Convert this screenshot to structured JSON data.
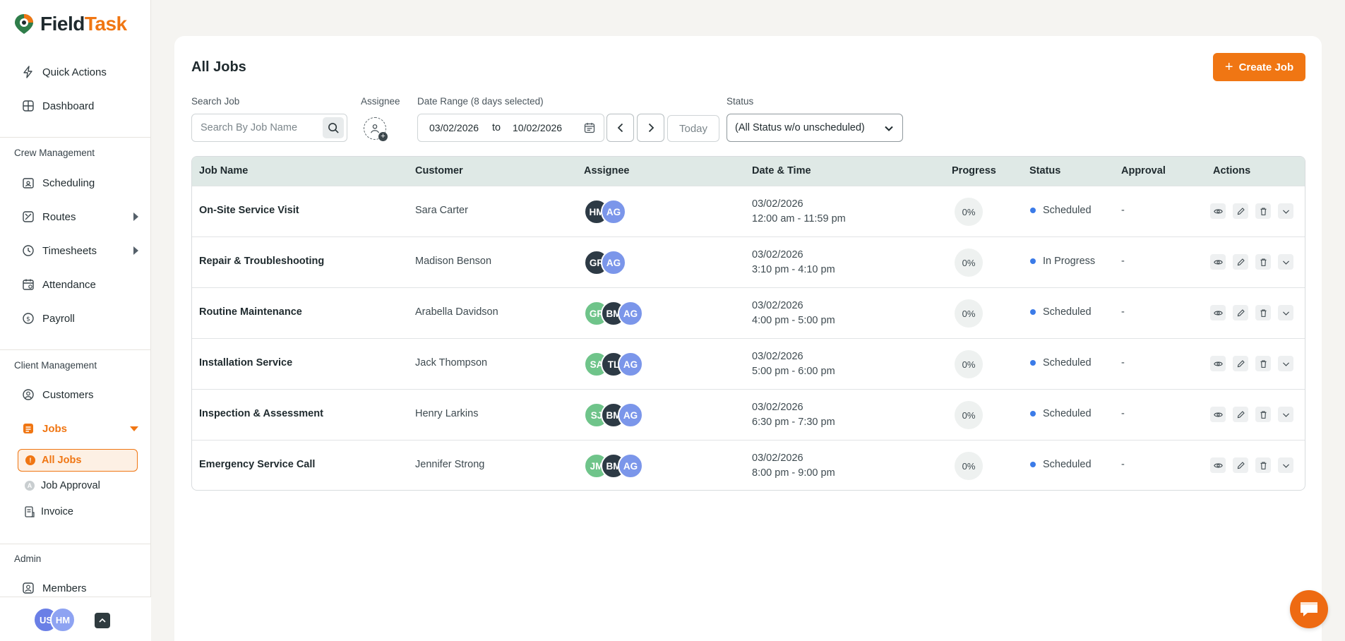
{
  "app": {
    "brand_first": "Field",
    "brand_second": "Task",
    "accent": "#f07613"
  },
  "sidebar": {
    "top_items": [
      {
        "label": "Quick Actions",
        "icon": "bolt-icon"
      },
      {
        "label": "Dashboard",
        "icon": "dashboard-icon"
      }
    ],
    "crew_label": "Crew Management",
    "crew_items": [
      {
        "label": "Scheduling",
        "icon": "scheduling-icon"
      },
      {
        "label": "Routes",
        "icon": "routes-icon",
        "expandable": true
      },
      {
        "label": "Timesheets",
        "icon": "clock-icon",
        "expandable": true
      },
      {
        "label": "Attendance",
        "icon": "attendance-icon"
      },
      {
        "label": "Payroll",
        "icon": "payroll-icon"
      }
    ],
    "client_label": "Client Management",
    "client_items": [
      {
        "label": "Customers",
        "icon": "customers-icon"
      },
      {
        "label": "Jobs",
        "icon": "jobs-icon",
        "expanded": true
      }
    ],
    "jobs_sub": [
      {
        "label": "All Jobs",
        "active": true
      },
      {
        "label": "Job Approval"
      },
      {
        "label": "Invoice"
      }
    ],
    "admin_label": "Admin",
    "admin_items": [
      {
        "label": "Members",
        "icon": "members-icon"
      }
    ],
    "footer_avatars": [
      {
        "initials": "US"
      },
      {
        "initials": "HM"
      }
    ]
  },
  "main": {
    "title": "All Jobs",
    "create_label": "Create Job",
    "filters": {
      "search_label": "Search Job",
      "search_placeholder": "Search By Job Name",
      "assignee_label": "Assignee",
      "date_label": "Date Range (8 days selected)",
      "date_from": "03/02/2026",
      "date_to_word": "to",
      "date_to": "10/02/2026",
      "today_label": "Today",
      "status_label": "Status",
      "status_value": "(All Status w/o unscheduled)"
    },
    "columns": {
      "job_name": "Job Name",
      "customer": "Customer",
      "assignee": "Assignee",
      "date_time": "Date & Time",
      "progress": "Progress",
      "status": "Status",
      "approval": "Approval",
      "actions": "Actions"
    },
    "rows": [
      {
        "job": "On-Site Service Visit",
        "customer": "Sara Carter",
        "assignees": [
          "HM",
          "AG"
        ],
        "date": "03/02/2026",
        "time": "12:00 am - 11:59 pm",
        "progress": "0%",
        "status": "Scheduled",
        "approval": "-"
      },
      {
        "job": "Repair & Troubleshooting",
        "customer": "Madison Benson",
        "assignees": [
          "GR",
          "AG"
        ],
        "date": "03/02/2026",
        "time": "3:10 pm - 4:10 pm",
        "progress": "0%",
        "status": "In Progress",
        "approval": "-"
      },
      {
        "job": "Routine Maintenance",
        "customer": "Arabella Davidson",
        "assignees": [
          "GR",
          "BM",
          "AG"
        ],
        "date": "03/02/2026",
        "time": "4:00 pm - 5:00 pm",
        "progress": "0%",
        "status": "Scheduled",
        "approval": "-"
      },
      {
        "job": "Installation Service",
        "customer": "Jack Thompson",
        "assignees": [
          "SA",
          "TL",
          "AG"
        ],
        "date": "03/02/2026",
        "time": "5:00 pm - 6:00 pm",
        "progress": "0%",
        "status": "Scheduled",
        "approval": "-"
      },
      {
        "job": "Inspection & Assessment",
        "customer": "Henry Larkins",
        "assignees": [
          "SJ",
          "BM",
          "AG"
        ],
        "date": "03/02/2026",
        "time": "6:30 pm - 7:30 pm",
        "progress": "0%",
        "status": "Scheduled",
        "approval": "-"
      },
      {
        "job": "Emergency Service Call",
        "customer": "Jennifer Strong",
        "assignees": [
          "JM",
          "BM",
          "AG"
        ],
        "date": "03/02/2026",
        "time": "8:00 pm - 9:00 pm",
        "progress": "0%",
        "status": "Scheduled",
        "approval": "-"
      }
    ]
  }
}
